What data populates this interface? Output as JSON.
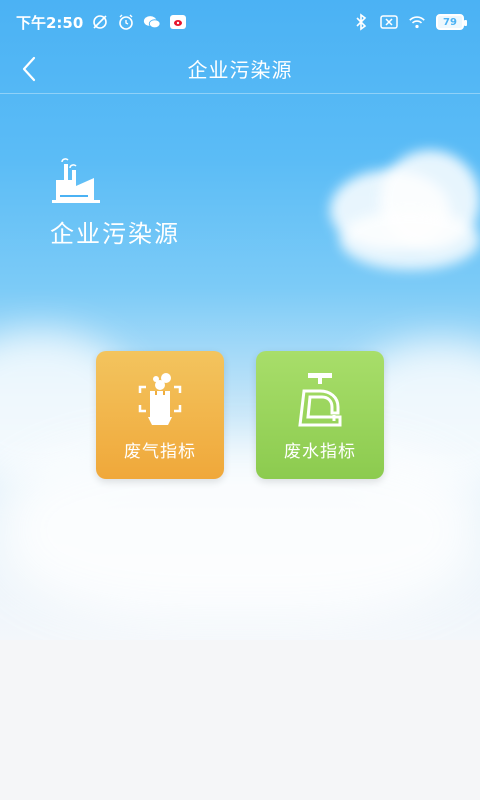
{
  "status_bar": {
    "time": "下午2:50",
    "battery": "79"
  },
  "header": {
    "title": "企业污染源"
  },
  "hero": {
    "title": "企业污染源"
  },
  "tiles": [
    {
      "label": "废气指标",
      "color": "#f0ad3e",
      "icon": "exhaust-icon"
    },
    {
      "label": "废水指标",
      "color": "#94d058",
      "icon": "faucet-icon"
    }
  ],
  "colors": {
    "sky_top": "#4bb2f4",
    "sky_bottom": "#f3f7fb",
    "background": "#f5f6f8"
  }
}
